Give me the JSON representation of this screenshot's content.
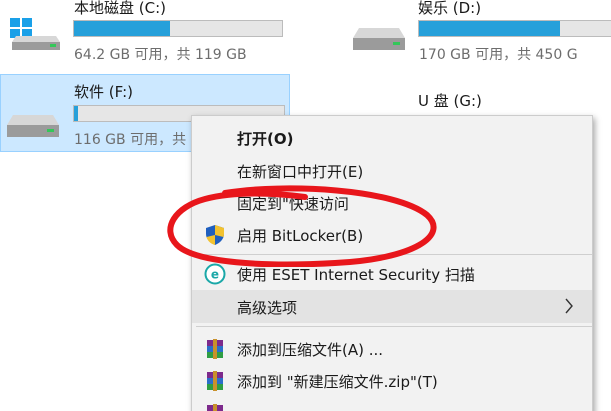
{
  "drives": [
    {
      "name": "本地磁盘 (C:)",
      "space": "64.2 GB 可用，共 119 GB",
      "used_fraction": 0.46
    },
    {
      "name": "娱乐 (D:)",
      "space": "170 GB 可用，共 450 G",
      "used_fraction": 0.62
    },
    {
      "name": "软件 (F:)",
      "space": "116 GB 可用，共",
      "used_fraction": 0.02
    },
    {
      "name": "U 盘 (G:)"
    }
  ],
  "menu": {
    "items": [
      {
        "label": "打开(O)"
      },
      {
        "label": "在新窗口中打开(E)"
      },
      {
        "label": "固定到\"快速访问"
      },
      {
        "label": "启用 BitLocker(B)"
      },
      {
        "label": "使用 ESET Internet Security 扫描"
      },
      {
        "label": "高级选项"
      },
      {
        "label": "添加到压缩文件(A) ..."
      },
      {
        "label": "添加到 \"新建压缩文件.zip\"(T)"
      }
    ]
  },
  "colors": {
    "selection": "#cce8ff",
    "bar_fill": "#26a0da",
    "menu_bg": "#f2f2f2",
    "annotation": "#e8161b"
  },
  "icons": {
    "drive_c": "windows-drive-icon",
    "drive": "hard-drive-icon",
    "bitlocker": "uac-shield-icon",
    "eset": "eset-icon",
    "submenu": "chevron-right-icon",
    "archive": "winrar-icon"
  }
}
